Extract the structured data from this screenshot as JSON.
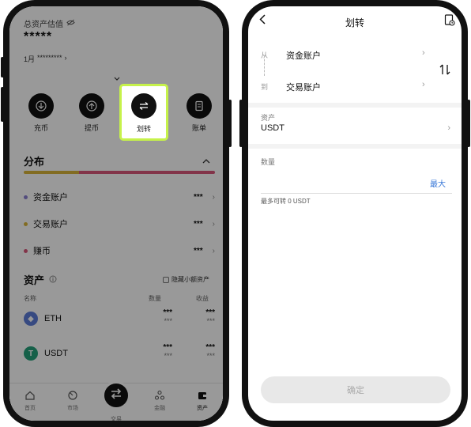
{
  "left_screen": {
    "total_label": "总资产估值",
    "total_value": "*****",
    "pnl_prefix": "1月",
    "pnl_value": "*********",
    "actions": [
      {
        "label": "充币",
        "icon": "deposit-icon"
      },
      {
        "label": "提币",
        "icon": "withdraw-icon"
      },
      {
        "label": "划转",
        "icon": "transfer-icon"
      },
      {
        "label": "账单",
        "icon": "bill-icon"
      }
    ],
    "distribution_title": "分布",
    "distribution_bar": [
      {
        "share": 0.29,
        "color": "#d9b53a"
      },
      {
        "share": 0.71,
        "color": "#d9577a"
      }
    ],
    "accounts": [
      {
        "name": "资金账户",
        "value": "***",
        "color": "#8a7fd1"
      },
      {
        "name": "交易账户",
        "value": "***",
        "color": "#d9b53a"
      },
      {
        "name": "赚币",
        "value": "***",
        "color": "#d9577a"
      }
    ],
    "assets_title": "资产",
    "hide_small": "隐藏小额资产",
    "col_name": "名称",
    "col_amount": "数量",
    "col_profit": "收益",
    "coins": [
      {
        "name": "ETH",
        "v1": "***",
        "v1_sub": "***",
        "v2": "***",
        "v2_sub": "***",
        "color": "#5c7cd8",
        "symbol": "◆"
      },
      {
        "name": "USDT",
        "v1": "***",
        "v1_sub": "***",
        "v2": "***",
        "v2_sub": "***",
        "color": "#26a17b",
        "symbol": "T"
      }
    ],
    "tabs": [
      {
        "label": "首页",
        "icon": "home-icon"
      },
      {
        "label": "市场",
        "icon": "market-icon"
      },
      {
        "label": "交易",
        "icon": "trade-icon"
      },
      {
        "label": "金融",
        "icon": "finance-icon"
      },
      {
        "label": "资产",
        "icon": "wallet-icon"
      }
    ]
  },
  "right_screen": {
    "title": "划转",
    "from_label": "从",
    "from_account": "资金账户",
    "to_label": "到",
    "to_account": "交易账户",
    "asset_label": "资产",
    "asset_value": "USDT",
    "amount_label": "数量",
    "max_label": "最大",
    "available_text": "最多可转 0 USDT",
    "confirm_label": "确定"
  }
}
